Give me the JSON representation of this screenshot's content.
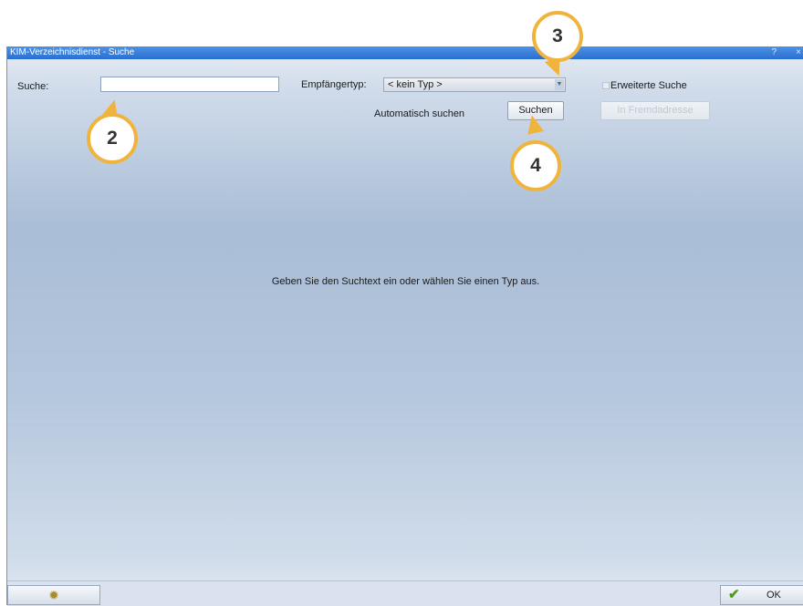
{
  "window": {
    "title": "KIM-Verzeichnisdienst - Suche",
    "help": "?",
    "close": "×"
  },
  "search": {
    "label": "Suche:",
    "value": "",
    "placeholder": ""
  },
  "recipient": {
    "label": "Empfängertyp:",
    "selected": "< kein Typ >"
  },
  "extended": {
    "label": "Erweiterte Suche"
  },
  "auto": {
    "label": "Automatisch suchen"
  },
  "buttons": {
    "search": "Suchen",
    "foreign_address": "In Fremdadresse",
    "ok": "OK"
  },
  "message": "Geben Sie den Suchtext ein oder wählen Sie einen Typ aus.",
  "callouts": {
    "c2": "2",
    "c3": "3",
    "c4": "4"
  },
  "icons": {
    "settings": "settings-gear-icon",
    "ok": "checkmark-icon",
    "dropdown": "dropdown-arrow-icon"
  },
  "colors": {
    "titlebar": "#2a6fcf",
    "callout_border": "#f0b43c",
    "ok_check": "#4c9a1e"
  }
}
